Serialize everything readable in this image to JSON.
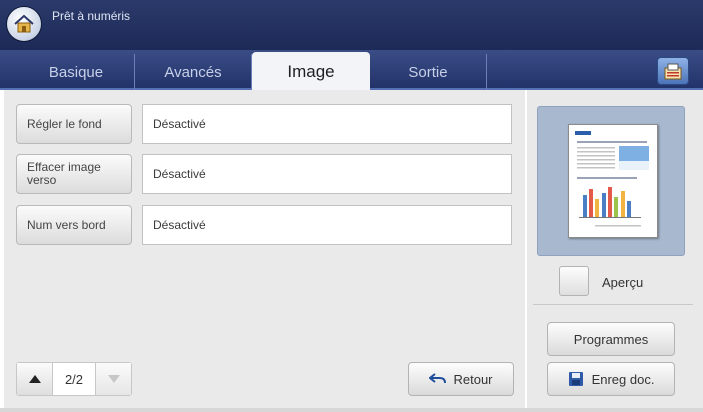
{
  "header": {
    "status_text": "Prêt à numéris"
  },
  "tabs": [
    {
      "label": "Basique",
      "active": false
    },
    {
      "label": "Avancés",
      "active": false
    },
    {
      "label": "Image",
      "active": true
    },
    {
      "label": "Sortie",
      "active": false
    }
  ],
  "settings": [
    {
      "button_label": "Régler le fond",
      "value": "Désactivé"
    },
    {
      "button_label": "Effacer image verso",
      "value": "Désactivé"
    },
    {
      "button_label": "Num vers bord",
      "value": "Désactivé"
    }
  ],
  "pager": {
    "page_text": "2/2"
  },
  "back_button": {
    "label": "Retour"
  },
  "side": {
    "preview_label": "Aperçu",
    "programs_label": "Programmes",
    "save_doc_label": "Enreg doc."
  },
  "colors": {
    "header_bg": "#1d2a57",
    "tabbar_bg": "#2e3f76",
    "panel_bg": "#eaeaeb",
    "preview_bg": "#a8b8ce"
  },
  "icons": {
    "home": "home-icon",
    "config": "job-settings-icon",
    "page_up": "triangle-up-icon",
    "page_down": "triangle-down-icon",
    "back": "undo-arrow-icon",
    "save": "floppy-disk-icon"
  }
}
